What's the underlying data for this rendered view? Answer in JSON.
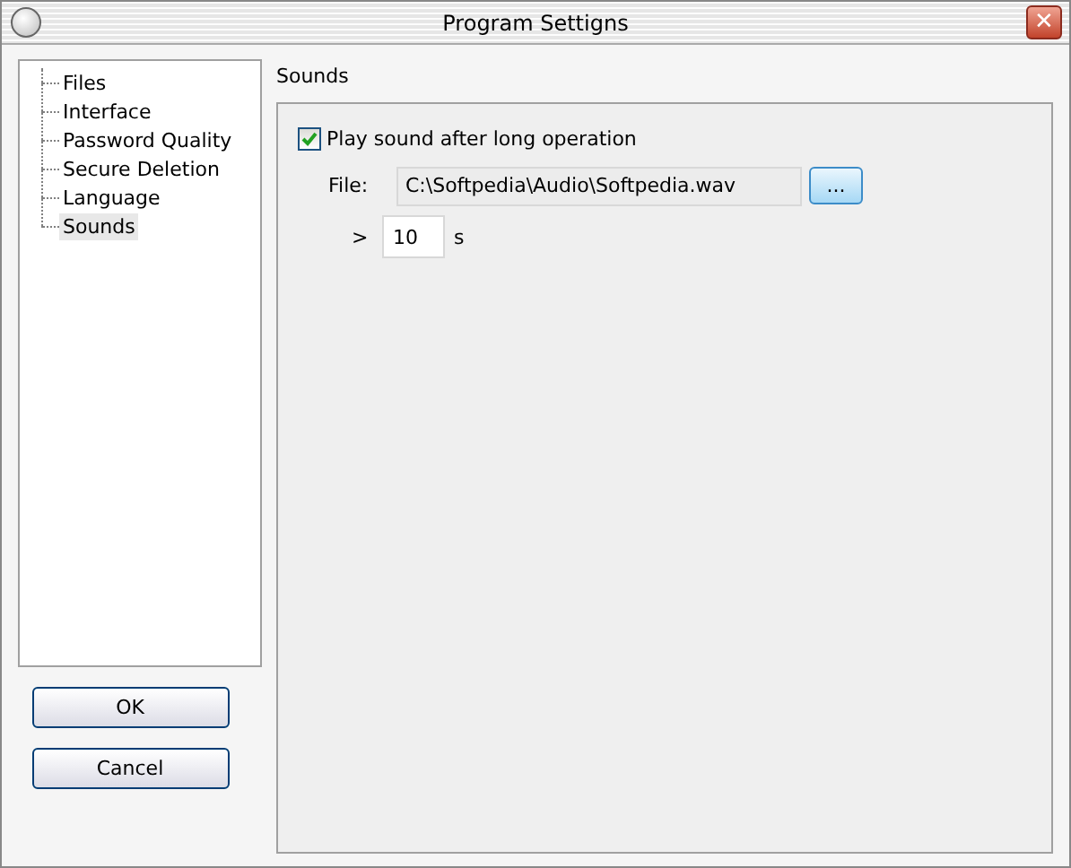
{
  "window": {
    "title": "Program Settigns",
    "close_label": "✕"
  },
  "tree": {
    "items": [
      {
        "label": "Files",
        "selected": false
      },
      {
        "label": "Interface",
        "selected": false
      },
      {
        "label": "Password Quality",
        "selected": false
      },
      {
        "label": "Secure Deletion",
        "selected": false
      },
      {
        "label": "Language",
        "selected": false
      },
      {
        "label": "Sounds",
        "selected": true
      }
    ]
  },
  "buttons": [
    "OK",
    "Cancel"
  ],
  "section": {
    "title": "Sounds",
    "play_sound": {
      "label": "Play sound after long operation",
      "checked": true
    },
    "file": {
      "label": "File:",
      "value": "C:\\Softpedia\\Audio\\Softpedia.wav",
      "browse_label": "..."
    },
    "threshold": {
      "prefix": ">",
      "value": "10",
      "unit": "s"
    }
  }
}
